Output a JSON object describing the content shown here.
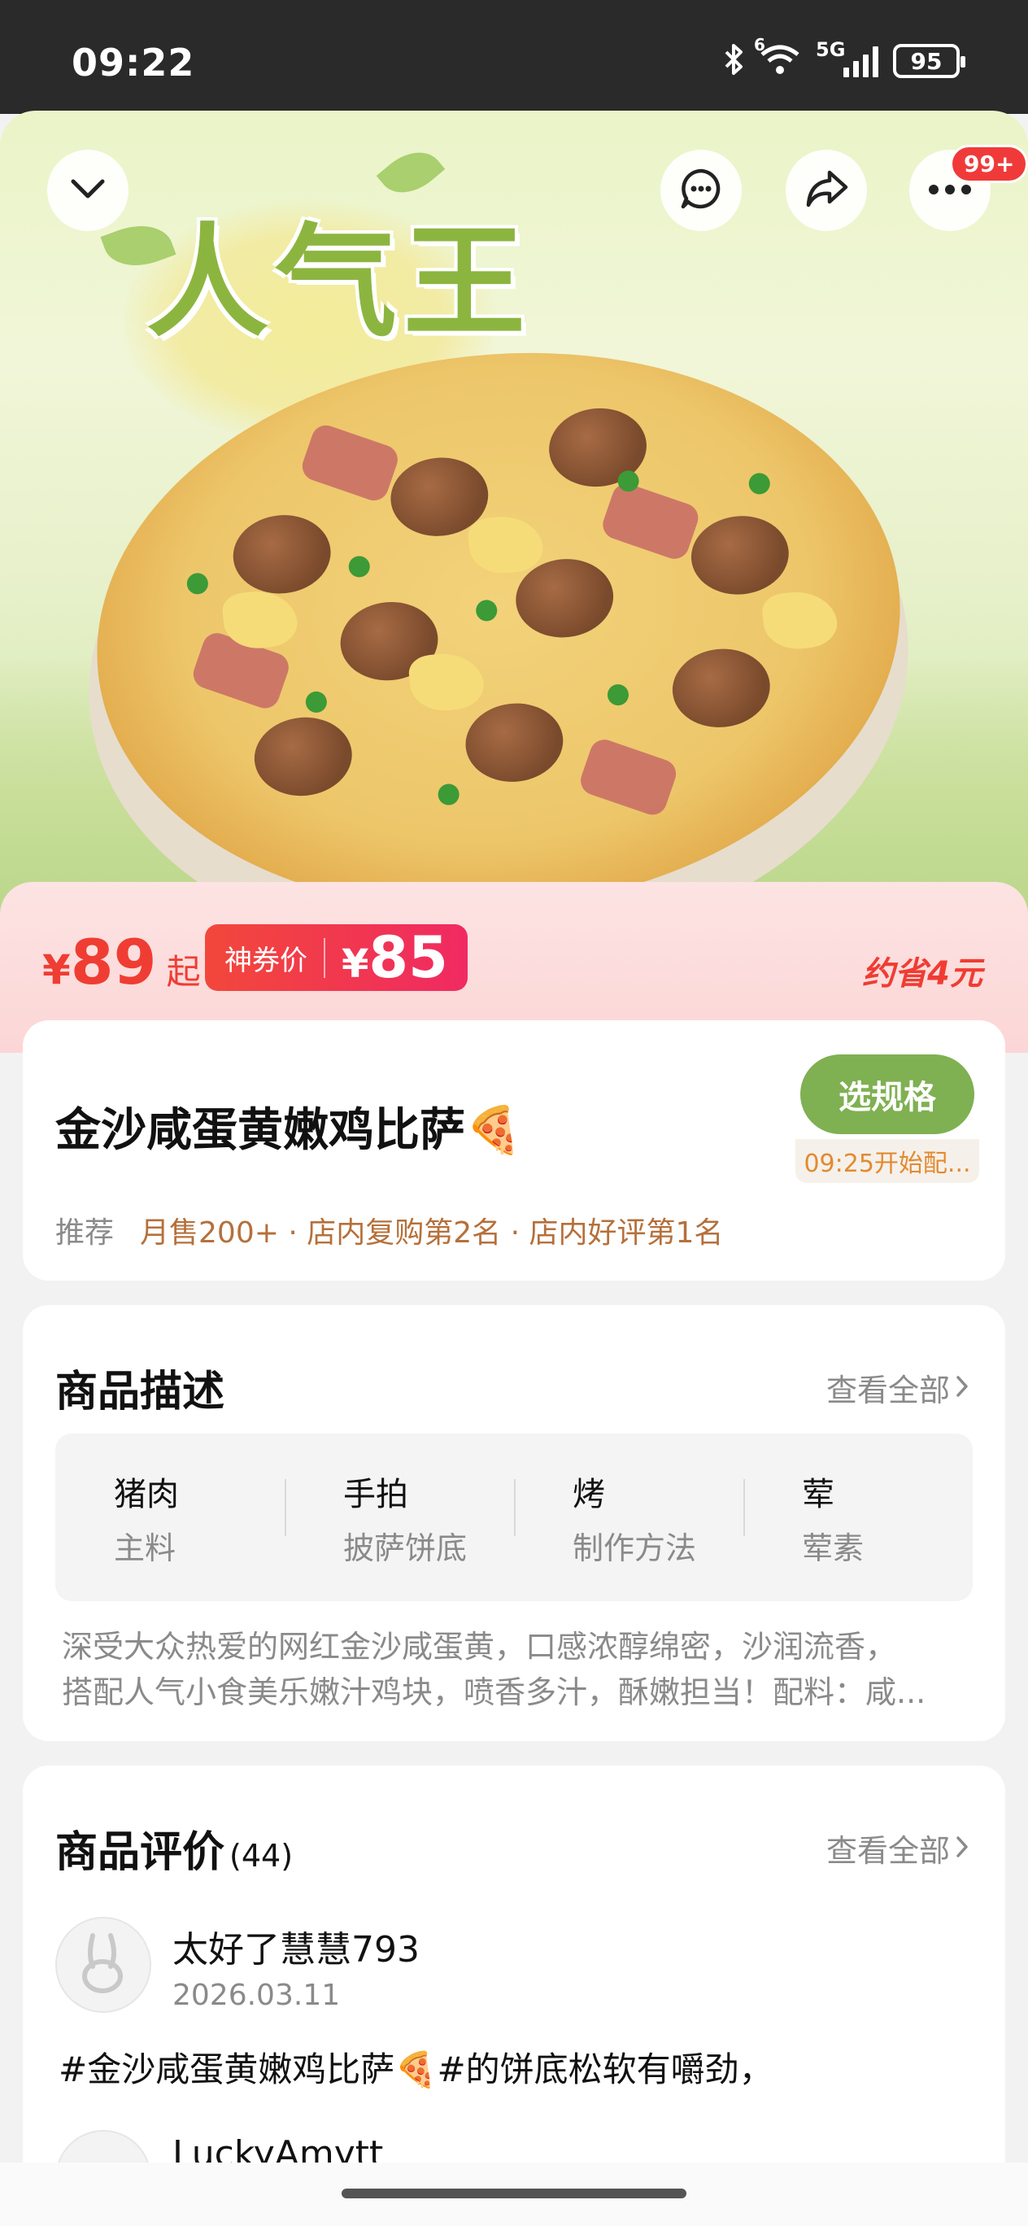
{
  "status_bar": {
    "time": "09:22",
    "network": "5G",
    "wifi_label": "6",
    "battery": "95",
    "icons": [
      "bluetooth-icon",
      "wifi-icon",
      "signal-icon",
      "battery-icon"
    ]
  },
  "hero": {
    "title": "人气王",
    "buttons": [
      "back-chevron-icon",
      "chat-icon",
      "share-icon",
      "more-icon"
    ],
    "more_badge": "99+"
  },
  "price": {
    "currency": "¥",
    "value": "89",
    "suffix": "起",
    "coupon_label": "神券价",
    "coupon_currency": "¥",
    "coupon_value": "85",
    "saving": "约省4元"
  },
  "product": {
    "name": "金沙咸蛋黄嫩鸡比萨🍕",
    "select_label": "选规格",
    "select_sub": "09:25开始配...",
    "recommend_label": "推荐",
    "highlights": "月售200+ · 店内复购第2名 · 店内好评第1名"
  },
  "description": {
    "title": "商品描述",
    "see_all": "查看全部",
    "attributes": [
      {
        "value": "猪肉",
        "label": "主料"
      },
      {
        "value": "手拍",
        "label": "披萨饼底"
      },
      {
        "value": "烤",
        "label": "制作方法"
      },
      {
        "value": "荤",
        "label": "荤素"
      }
    ],
    "text_line1": "深受大众热爱的网红金沙咸蛋黄，口感浓醇绵密，沙润流香，",
    "text_line2": "搭配人气小食美乐嫩汁鸡块，喷香多汁，酥嫩担当！配料：咸..."
  },
  "reviews": {
    "title": "商品评价",
    "count": "(44)",
    "see_all": "查看全部",
    "items": [
      {
        "user": "太好了慧慧793",
        "date": "2026.03.11",
        "text": "#金沙咸蛋黄嫩鸡比萨🍕#的饼底松软有嚼劲，"
      },
      {
        "user": "LuckyAmytt"
      }
    ]
  },
  "colors": {
    "accent_red": "#ef3d33",
    "select_green": "#7fb052",
    "hero_title_green": "#8cb540"
  }
}
